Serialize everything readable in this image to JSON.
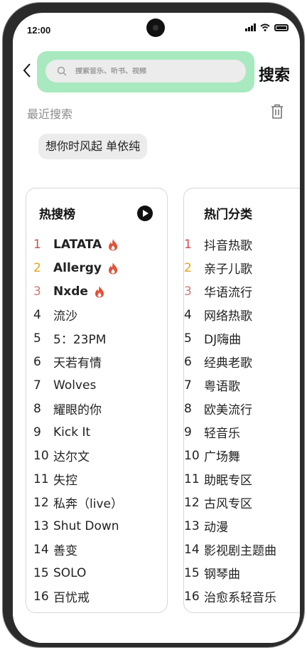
{
  "status_bar": {
    "time": "12:00"
  },
  "header": {
    "back_icon": "chevron-left-icon",
    "search_placeholder": "搜索音乐、听书、视频",
    "search_button_label": "搜索",
    "highlight_color": "#a8e9bf"
  },
  "recent": {
    "title": "最近搜索",
    "items": [
      "想你时风起 单依纯"
    ]
  },
  "hot_list": {
    "title": "热搜榜",
    "items": [
      {
        "rank": "1",
        "name": "LATATA",
        "hot": true
      },
      {
        "rank": "2",
        "name": "Allergy",
        "hot": true
      },
      {
        "rank": "3",
        "name": "Nxde",
        "hot": true
      },
      {
        "rank": "4",
        "name": "流沙",
        "hot": false
      },
      {
        "rank": "5",
        "name": "5：23PM",
        "hot": false
      },
      {
        "rank": "6",
        "name": "天若有情",
        "hot": false
      },
      {
        "rank": "7",
        "name": "Wolves",
        "hot": false
      },
      {
        "rank": "8",
        "name": "耀眼的你",
        "hot": false
      },
      {
        "rank": "9",
        "name": "Kick It",
        "hot": false
      },
      {
        "rank": "10",
        "name": "达尔文",
        "hot": false
      },
      {
        "rank": "11",
        "name": "失控",
        "hot": false
      },
      {
        "rank": "12",
        "name": "私奔（live）",
        "hot": false
      },
      {
        "rank": "13",
        "name": "Shut Down",
        "hot": false
      },
      {
        "rank": "14",
        "name": "善变",
        "hot": false
      },
      {
        "rank": "15",
        "name": "SOLO",
        "hot": false
      },
      {
        "rank": "16",
        "name": "百忧戒",
        "hot": false
      }
    ]
  },
  "categories": {
    "title": "热门分类",
    "items": [
      {
        "rank": "1",
        "name": "抖音热歌"
      },
      {
        "rank": "2",
        "name": "亲子儿歌"
      },
      {
        "rank": "3",
        "name": "华语流行"
      },
      {
        "rank": "4",
        "name": "网络热歌"
      },
      {
        "rank": "5",
        "name": "DJ嗨曲"
      },
      {
        "rank": "6",
        "name": "经典老歌"
      },
      {
        "rank": "7",
        "name": "粤语歌"
      },
      {
        "rank": "8",
        "name": "欧美流行"
      },
      {
        "rank": "9",
        "name": "轻音乐"
      },
      {
        "rank": "10",
        "name": "广场舞"
      },
      {
        "rank": "11",
        "name": "助眠专区"
      },
      {
        "rank": "12",
        "name": "古风专区"
      },
      {
        "rank": "13",
        "name": "动漫"
      },
      {
        "rank": "14",
        "name": "影视剧主题曲"
      },
      {
        "rank": "15",
        "name": "钢琴曲"
      },
      {
        "rank": "16",
        "name": "治愈系轻音乐"
      }
    ]
  },
  "colors": {
    "rank1": "#d24a4a",
    "rank2": "#e2a417",
    "rank3": "#d07878",
    "flame": "#e0523a"
  }
}
